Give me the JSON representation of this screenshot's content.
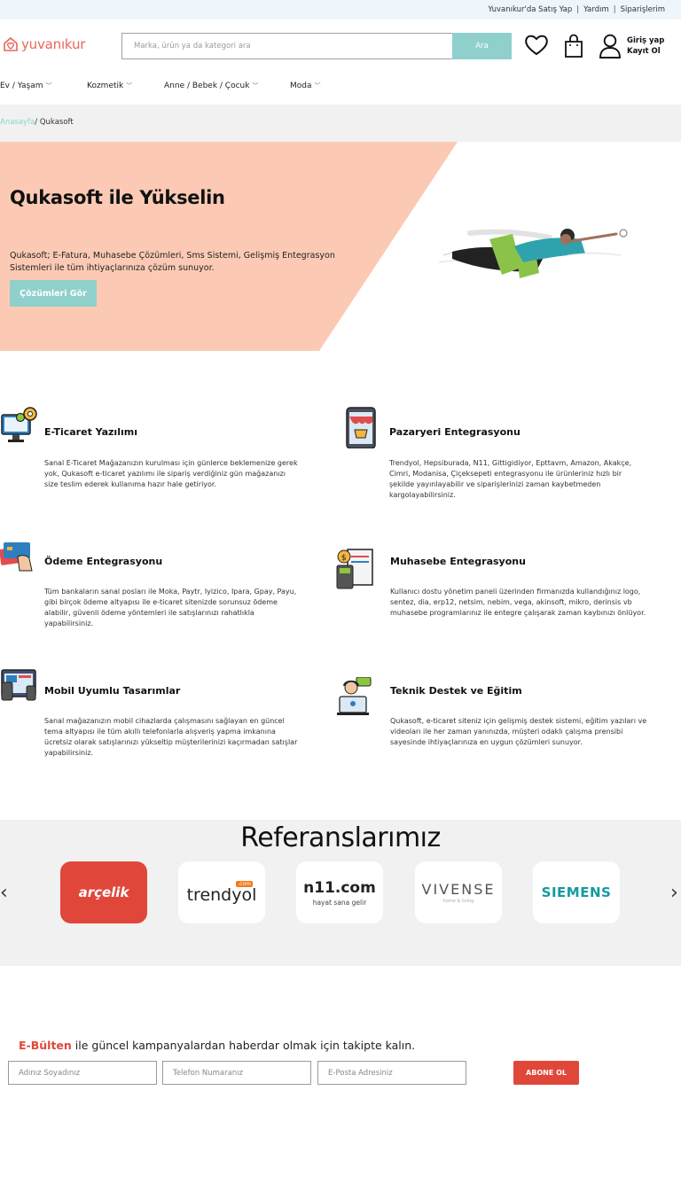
{
  "topbar": {
    "links": [
      "Yuvanıkur'da Satış Yap",
      "Yardım",
      "Siparişlerim"
    ]
  },
  "header": {
    "logo_text": "yuvanıkur",
    "search_placeholder": "Marka, ürün ya da kategori ara",
    "search_button": "Ara",
    "login_label": "Giriş yap",
    "register_label": "Kayıt Ol"
  },
  "nav": {
    "items": [
      {
        "label": "Ev / Yaşam"
      },
      {
        "label": "Kozmetik"
      },
      {
        "label": "Anne / Bebek / Çocuk"
      },
      {
        "label": "Moda"
      }
    ]
  },
  "breadcrumb": {
    "home": "Anasayfa",
    "separator": "/ ",
    "current": "Qukasoft"
  },
  "hero": {
    "title": "Qukasoft ile Yükselin",
    "description": "Qukasoft; E-Fatura, Muhasebe Çözümleri, Sms Sistemi, Gelişmiş Entegrasyon Sistemleri ile tüm ihtiyaçlarınıza çözüm sunuyor.",
    "cta": "Çözümleri Gör",
    "bg_color": "#fccab4"
  },
  "features": [
    {
      "title": "E-Ticaret Yazılımı",
      "icon": "computer-gear-icon",
      "text": "Sanal E-Ticaret Mağazanızın kurulması için günlerce beklemenize gerek yok, Qukasoft e-ticaret yazılımı ile sipariş verdiğiniz gün mağazanızı size teslim ederek kullanıma hazır hale getiriyor."
    },
    {
      "title": "Pazaryeri Entegrasyonu",
      "icon": "mobile-shop-icon",
      "text": "Trendyol, Hepsiburada, N11, Gittigidiyor, Epttavm, Amazon, Akakçe, Cimri, Modanisa, Çiçeksepeti entegrasyonu ile ürünleriniz hızlı bir şekilde yayınlayabilir ve siparişlerinizi zaman kaybetmeden kargolayabilirsiniz."
    },
    {
      "title": "Ödeme Entegrasyonu",
      "icon": "credit-card-icon",
      "text": "Tüm bankaların sanal posları ile Moka, Paytr, Iyizico, Ipara, Gpay, Payu, gibi birçok ödeme altyapısı ile e-ticaret sitenizde sorunsuz ödeme alabilir, güvenli ödeme yöntemleri ile satışlarınızı rahatlıkla yapabilirsiniz."
    },
    {
      "title": "Muhasebe Entegrasyonu",
      "icon": "accounting-icon",
      "text": "Kullanıcı dostu yönetim paneli üzerinden firmanızda kullandığınız logo, sentez, dia, erp12, netsim, nebim, vega, akinsoft, mikro, derinsis vb muhasebe programlarınız ile entegre çalışarak zaman kaybınızı önlüyor."
    },
    {
      "title": "Mobil Uyumlu Tasarımlar",
      "icon": "responsive-devices-icon",
      "text": "Sanal mağazanızın mobil cihazlarda çalışmasını sağlayan en güncel tema altyapısı ile tüm akıllı telefonlarla alışveriş yapma imkanına ücretsiz olarak satışlarınızı yükseltip müşterilerinizi kaçırmadan satışlar yapabilirsiniz."
    },
    {
      "title": "Teknik Destek ve Eğitim",
      "icon": "support-agent-icon",
      "text": "Qukasoft, e-ticaret siteniz için gelişmiş destek sistemi, eğitim yazıları ve videoları ile her zaman yanınızda, müşteri odaklı çalışma prensibi sayesinde ihtiyaçlarınıza en uygun çözümleri sunuyor."
    }
  ],
  "references": {
    "title": "Referanslarımız",
    "brands": [
      {
        "name": "arçelik"
      },
      {
        "name": "trendyol",
        "badge": ".com"
      },
      {
        "name": "n11.com",
        "tagline": "hayat sana gelir"
      },
      {
        "name": "VIVENSE",
        "tagline": "home & living"
      },
      {
        "name": "SIEMENS"
      }
    ]
  },
  "newsletter": {
    "accent": "E-Bülten",
    "text": " ile güncel kampanyalardan haberdar olmak için takipte kalın.",
    "name_placeholder": "Adınız Soyadınız",
    "phone_placeholder": "Telefon Numaranız",
    "email_placeholder": "E-Posta Adresiniz",
    "button": "ABONE OL"
  }
}
